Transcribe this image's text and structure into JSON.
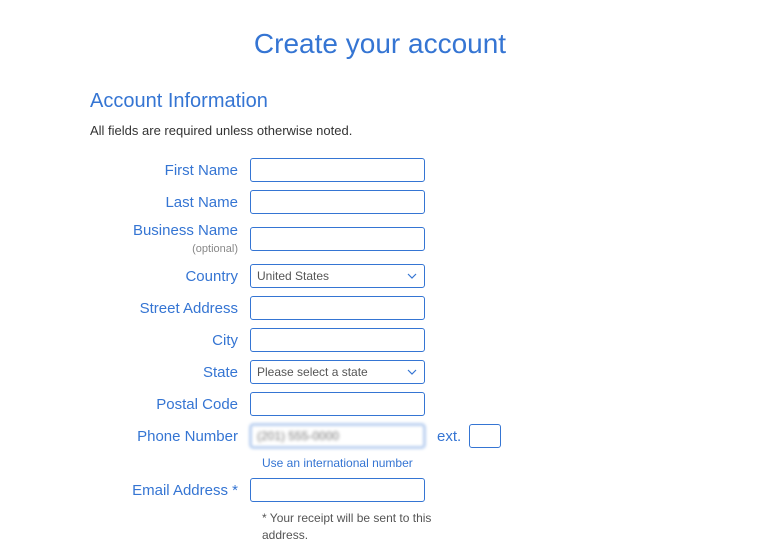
{
  "page_title": "Create your account",
  "section_title": "Account Information",
  "required_note": "All fields are required unless otherwise noted.",
  "labels": {
    "first_name": "First Name",
    "last_name": "Last Name",
    "business_name": "Business Name",
    "business_optional": " (optional)",
    "country": "Country",
    "street": "Street Address",
    "city": "City",
    "state": "State",
    "postal": "Postal Code",
    "phone": "Phone Number",
    "ext": "ext.",
    "email": "Email Address *"
  },
  "values": {
    "first_name": "",
    "last_name": "",
    "business_name": "",
    "country": "United States",
    "street": "",
    "city": "",
    "state": "Please select a state",
    "postal": "",
    "phone": "",
    "phone_placeholder": "(201) 555-0000",
    "ext": "",
    "email": ""
  },
  "intl_link": "Use an international number",
  "receipt_note": "* Your receipt will be sent to this address."
}
